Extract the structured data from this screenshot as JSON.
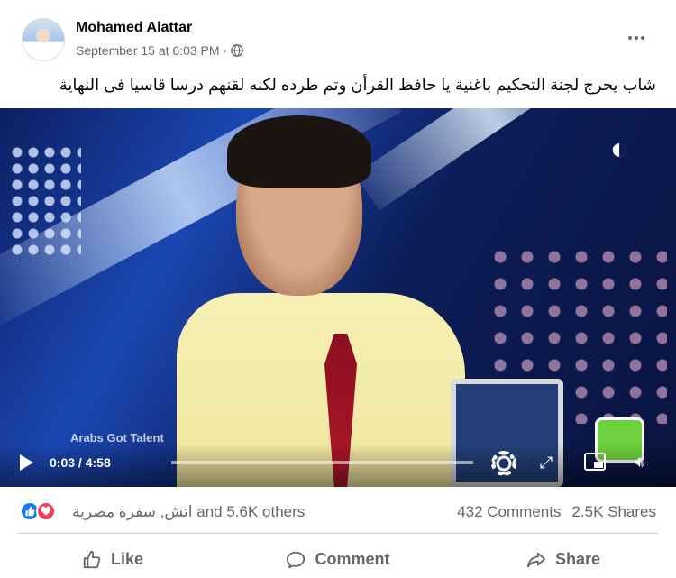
{
  "post": {
    "author": "Mohamed Alattar",
    "timestamp": "September 15 at 6:03 PM",
    "separator": "·",
    "privacy_icon": "globe-icon",
    "text": "شاب يحرج لجنة التحكيم باغنية يا حافظ القرأن وتم طرده لكنه لقنهم درسا قاسيا فى النهاية"
  },
  "video": {
    "watermark": "Arabs Got Talent",
    "current_time": "0:03",
    "duration": "4:58",
    "time_separator": " / ",
    "progress_fraction": 0.01
  },
  "reactions": {
    "icons": [
      "like-icon",
      "love-icon"
    ],
    "names": "اتش, سفرة مصرية",
    "others": "and 5.6K others",
    "comments": "432 Comments",
    "shares": "2.5K Shares"
  },
  "actions": {
    "like": "Like",
    "comment": "Comment",
    "share": "Share"
  },
  "colors": {
    "like_blue": "#1877f2",
    "love_red": "#f33e58",
    "secondary_text": "#65676b"
  }
}
